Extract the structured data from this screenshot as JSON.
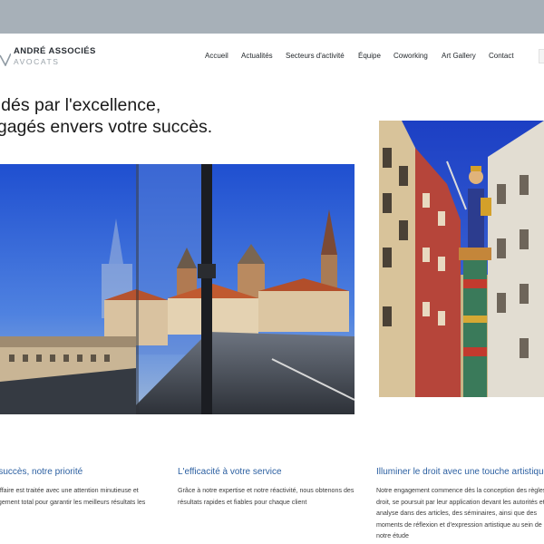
{
  "header": {
    "brand_name": "ANDRÉ ASSOCIÉS",
    "brand_sub": "AVOCATS",
    "nav": [
      {
        "label": "Accueil"
      },
      {
        "label": "Actualités"
      },
      {
        "label": "Secteurs d'activité"
      },
      {
        "label": "Équipe"
      },
      {
        "label": "Coworking"
      },
      {
        "label": "Art Gallery"
      },
      {
        "label": "Contact"
      }
    ]
  },
  "hero": {
    "title_line1": "uidés par l'excellence,",
    "title_line2": "ngagés envers votre succès."
  },
  "features": [
    {
      "title": "e succès, notre priorité",
      "text": "e affaire est traitée avec une attention minutieuse et gagement total pour garantir les meilleurs résultats les"
    },
    {
      "title": "L'efficacité à votre service",
      "text": "Grâce à notre expertise et notre réactivité, nous obtenons des résultats rapides et fiables pour chaque client"
    },
    {
      "title": "Illuminer le droit avec une touche artistique",
      "text": "Notre engagement commence dès la conception des règles de droit, se poursuit par leur application devant les autorités et leur analyse dans des articles, des séminaires, ainsi que des moments de réflexion et d'expression artistique au sein de notre étude"
    }
  ],
  "colors": {
    "topbar": "#a7b0b8",
    "accent": "#2b5fa1",
    "text": "#1a1a1a"
  },
  "icons": {
    "logo": "v-logo-mark"
  }
}
